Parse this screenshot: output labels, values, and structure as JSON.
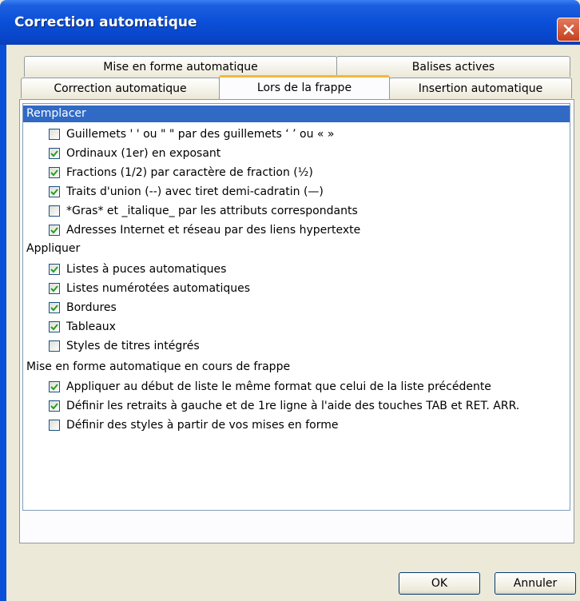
{
  "window": {
    "title": "Correction automatique"
  },
  "tabs_row1": [
    "Mise en forme automatique",
    "Balises actives"
  ],
  "tabs_row2": [
    "Correction automatique",
    "Lors de la frappe",
    "Insertion automatique"
  ],
  "active_tab": "Lors de la frappe",
  "groups": {
    "replace": "Remplacer",
    "apply": "Appliquer",
    "format": "Mise en forme automatique en cours de frappe"
  },
  "replace_items": [
    {
      "label": "Guillemets ' ' ou \" \" par des guillemets ‘ ’ ou « »",
      "checked": false
    },
    {
      "label": "Ordinaux (1er) en exposant",
      "checked": true
    },
    {
      "label": "Fractions (1/2) par caractère de fraction (½)",
      "checked": true
    },
    {
      "label": "Traits d'union (--) avec tiret demi-cadratin (—)",
      "checked": true
    },
    {
      "label": "*Gras* et _italique_ par les attributs correspondants",
      "checked": false
    },
    {
      "label": "Adresses Internet et réseau par des liens hypertexte",
      "checked": true
    }
  ],
  "apply_items": [
    {
      "label": "Listes à puces automatiques",
      "checked": true
    },
    {
      "label": "Listes numérotées automatiques",
      "checked": true
    },
    {
      "label": "Bordures",
      "checked": true
    },
    {
      "label": "Tableaux",
      "checked": true
    },
    {
      "label": "Styles de titres intégrés",
      "checked": false
    }
  ],
  "format_items": [
    {
      "label": "Appliquer au début de liste le même format que celui de la liste précédente",
      "checked": true
    },
    {
      "label": "Définir les retraits à gauche et de 1re ligne à l'aide des touches TAB et RET. ARR.",
      "checked": true
    },
    {
      "label": "Définir des styles à partir de vos mises en forme",
      "checked": false
    }
  ],
  "buttons": {
    "ok": "OK",
    "cancel": "Annuler"
  },
  "colors": {
    "title_bar": "#0a4fd8",
    "selection": "#316ac5",
    "check": "#21a121"
  }
}
